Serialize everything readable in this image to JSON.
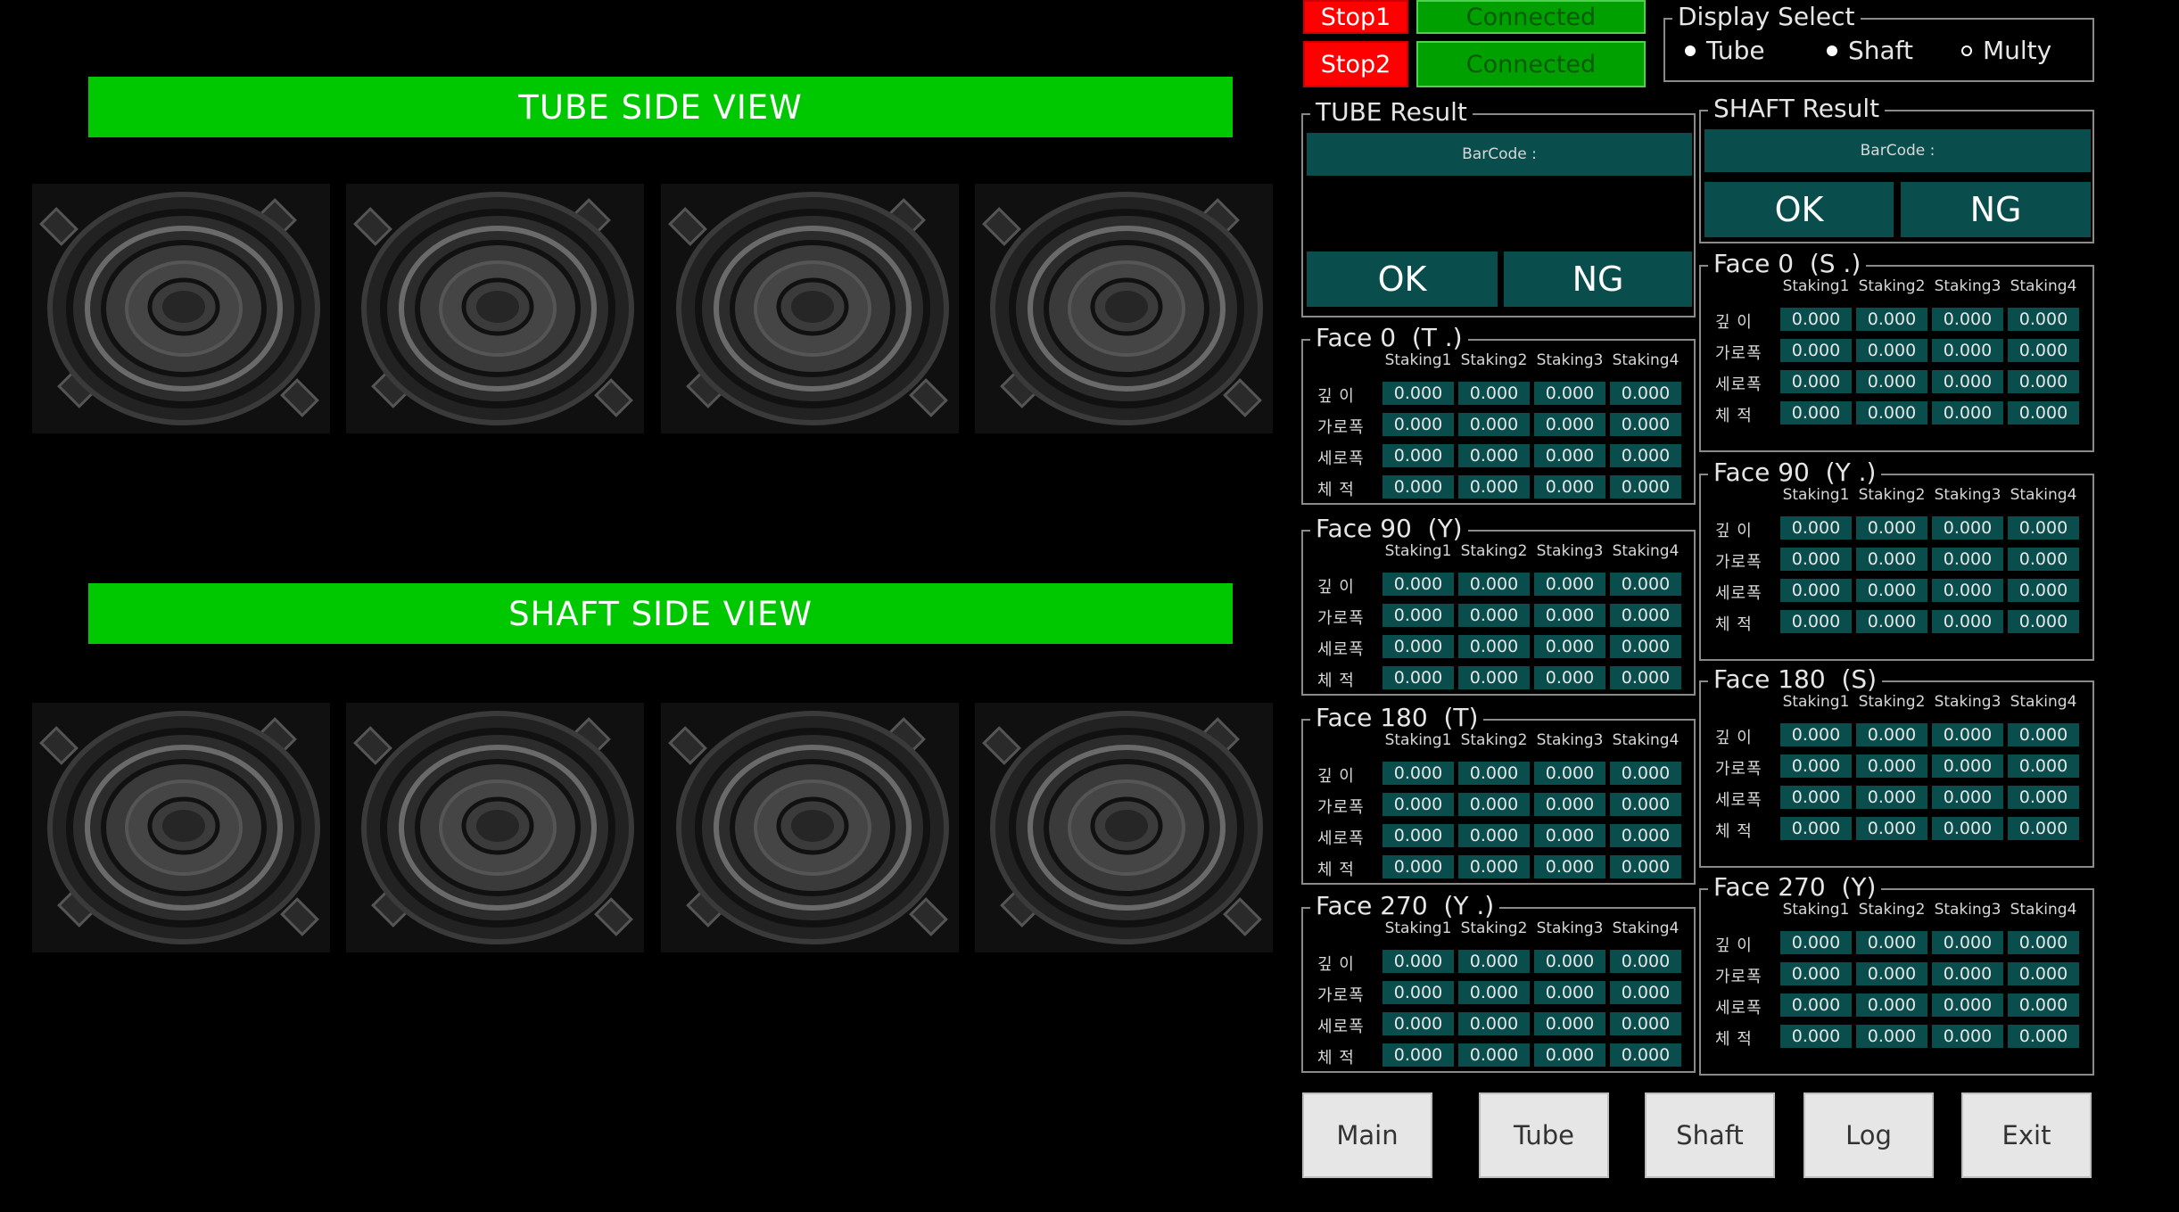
{
  "views": {
    "tube_title": "TUBE SIDE VIEW",
    "shaft_title": "SHAFT SIDE VIEW"
  },
  "status": {
    "stop1": "Stop1",
    "stop2": "Stop2",
    "conn1": "Connected",
    "conn2": "Connected"
  },
  "display_select": {
    "title": "Display Select",
    "options": [
      "Tube",
      "Shaft",
      "Multy"
    ]
  },
  "tube_result": {
    "title": "TUBE Result",
    "barcode": "BarCode :",
    "ok": "OK",
    "ng": "NG"
  },
  "shaft_result": {
    "title": "SHAFT Result",
    "barcode": "BarCode :",
    "ok": "OK",
    "ng": "NG"
  },
  "row_labels": [
    "깊 이",
    "가로폭",
    "세로폭",
    "체 적"
  ],
  "col_labels": [
    "Staking1",
    "Staking2",
    "Staking3",
    "Staking4"
  ],
  "tube_faces": [
    {
      "title": "Face 0  (T .)",
      "values": [
        [
          "0.000",
          "0.000",
          "0.000",
          "0.000"
        ],
        [
          "0.000",
          "0.000",
          "0.000",
          "0.000"
        ],
        [
          "0.000",
          "0.000",
          "0.000",
          "0.000"
        ],
        [
          "0.000",
          "0.000",
          "0.000",
          "0.000"
        ]
      ]
    },
    {
      "title": "Face 90  (Y)",
      "values": [
        [
          "0.000",
          "0.000",
          "0.000",
          "0.000"
        ],
        [
          "0.000",
          "0.000",
          "0.000",
          "0.000"
        ],
        [
          "0.000",
          "0.000",
          "0.000",
          "0.000"
        ],
        [
          "0.000",
          "0.000",
          "0.000",
          "0.000"
        ]
      ]
    },
    {
      "title": "Face 180  (T)",
      "values": [
        [
          "0.000",
          "0.000",
          "0.000",
          "0.000"
        ],
        [
          "0.000",
          "0.000",
          "0.000",
          "0.000"
        ],
        [
          "0.000",
          "0.000",
          "0.000",
          "0.000"
        ],
        [
          "0.000",
          "0.000",
          "0.000",
          "0.000"
        ]
      ]
    },
    {
      "title": "Face 270  (Y .)",
      "values": [
        [
          "0.000",
          "0.000",
          "0.000",
          "0.000"
        ],
        [
          "0.000",
          "0.000",
          "0.000",
          "0.000"
        ],
        [
          "0.000",
          "0.000",
          "0.000",
          "0.000"
        ],
        [
          "0.000",
          "0.000",
          "0.000",
          "0.000"
        ]
      ]
    }
  ],
  "shaft_faces": [
    {
      "title": "Face 0  (S .)",
      "values": [
        [
          "0.000",
          "0.000",
          "0.000",
          "0.000"
        ],
        [
          "0.000",
          "0.000",
          "0.000",
          "0.000"
        ],
        [
          "0.000",
          "0.000",
          "0.000",
          "0.000"
        ],
        [
          "0.000",
          "0.000",
          "0.000",
          "0.000"
        ]
      ]
    },
    {
      "title": "Face 90  (Y .)",
      "values": [
        [
          "0.000",
          "0.000",
          "0.000",
          "0.000"
        ],
        [
          "0.000",
          "0.000",
          "0.000",
          "0.000"
        ],
        [
          "0.000",
          "0.000",
          "0.000",
          "0.000"
        ],
        [
          "0.000",
          "0.000",
          "0.000",
          "0.000"
        ]
      ]
    },
    {
      "title": "Face 180  (S)",
      "values": [
        [
          "0.000",
          "0.000",
          "0.000",
          "0.000"
        ],
        [
          "0.000",
          "0.000",
          "0.000",
          "0.000"
        ],
        [
          "0.000",
          "0.000",
          "0.000",
          "0.000"
        ],
        [
          "0.000",
          "0.000",
          "0.000",
          "0.000"
        ]
      ]
    },
    {
      "title": "Face 270  (Y)",
      "values": [
        [
          "0.000",
          "0.000",
          "0.000",
          "0.000"
        ],
        [
          "0.000",
          "0.000",
          "0.000",
          "0.000"
        ],
        [
          "0.000",
          "0.000",
          "0.000",
          "0.000"
        ],
        [
          "0.000",
          "0.000",
          "0.000",
          "0.000"
        ]
      ]
    }
  ],
  "nav": {
    "main": "Main",
    "tube": "Tube",
    "shaft": "Shaft",
    "log": "Log",
    "exit": "Exit"
  }
}
